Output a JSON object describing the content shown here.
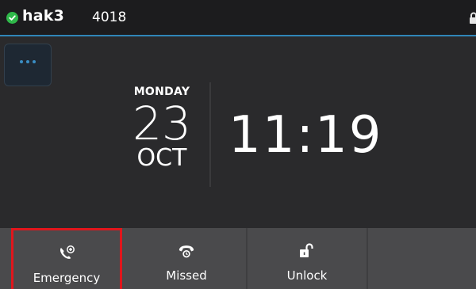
{
  "status": {
    "account_name": "hak3",
    "extension": "4018",
    "registered_icon": "check-circle-icon",
    "lock_icon": "padlock-icon"
  },
  "clock": {
    "weekday": "MONDAY",
    "day": "23",
    "month": "OCT",
    "time": "11:19"
  },
  "more_button": {
    "icon": "more-dots-icon"
  },
  "softkeys": [
    {
      "label": "Emergency",
      "icon": "emergency-call-icon",
      "highlighted": true
    },
    {
      "label": "Missed",
      "icon": "missed-call-icon",
      "highlighted": false
    },
    {
      "label": "Unlock",
      "icon": "unlock-icon",
      "highlighted": false
    }
  ],
  "colors": {
    "accent": "#2f86b8",
    "status_ok": "#2fb84a",
    "highlight": "#e0161c"
  }
}
